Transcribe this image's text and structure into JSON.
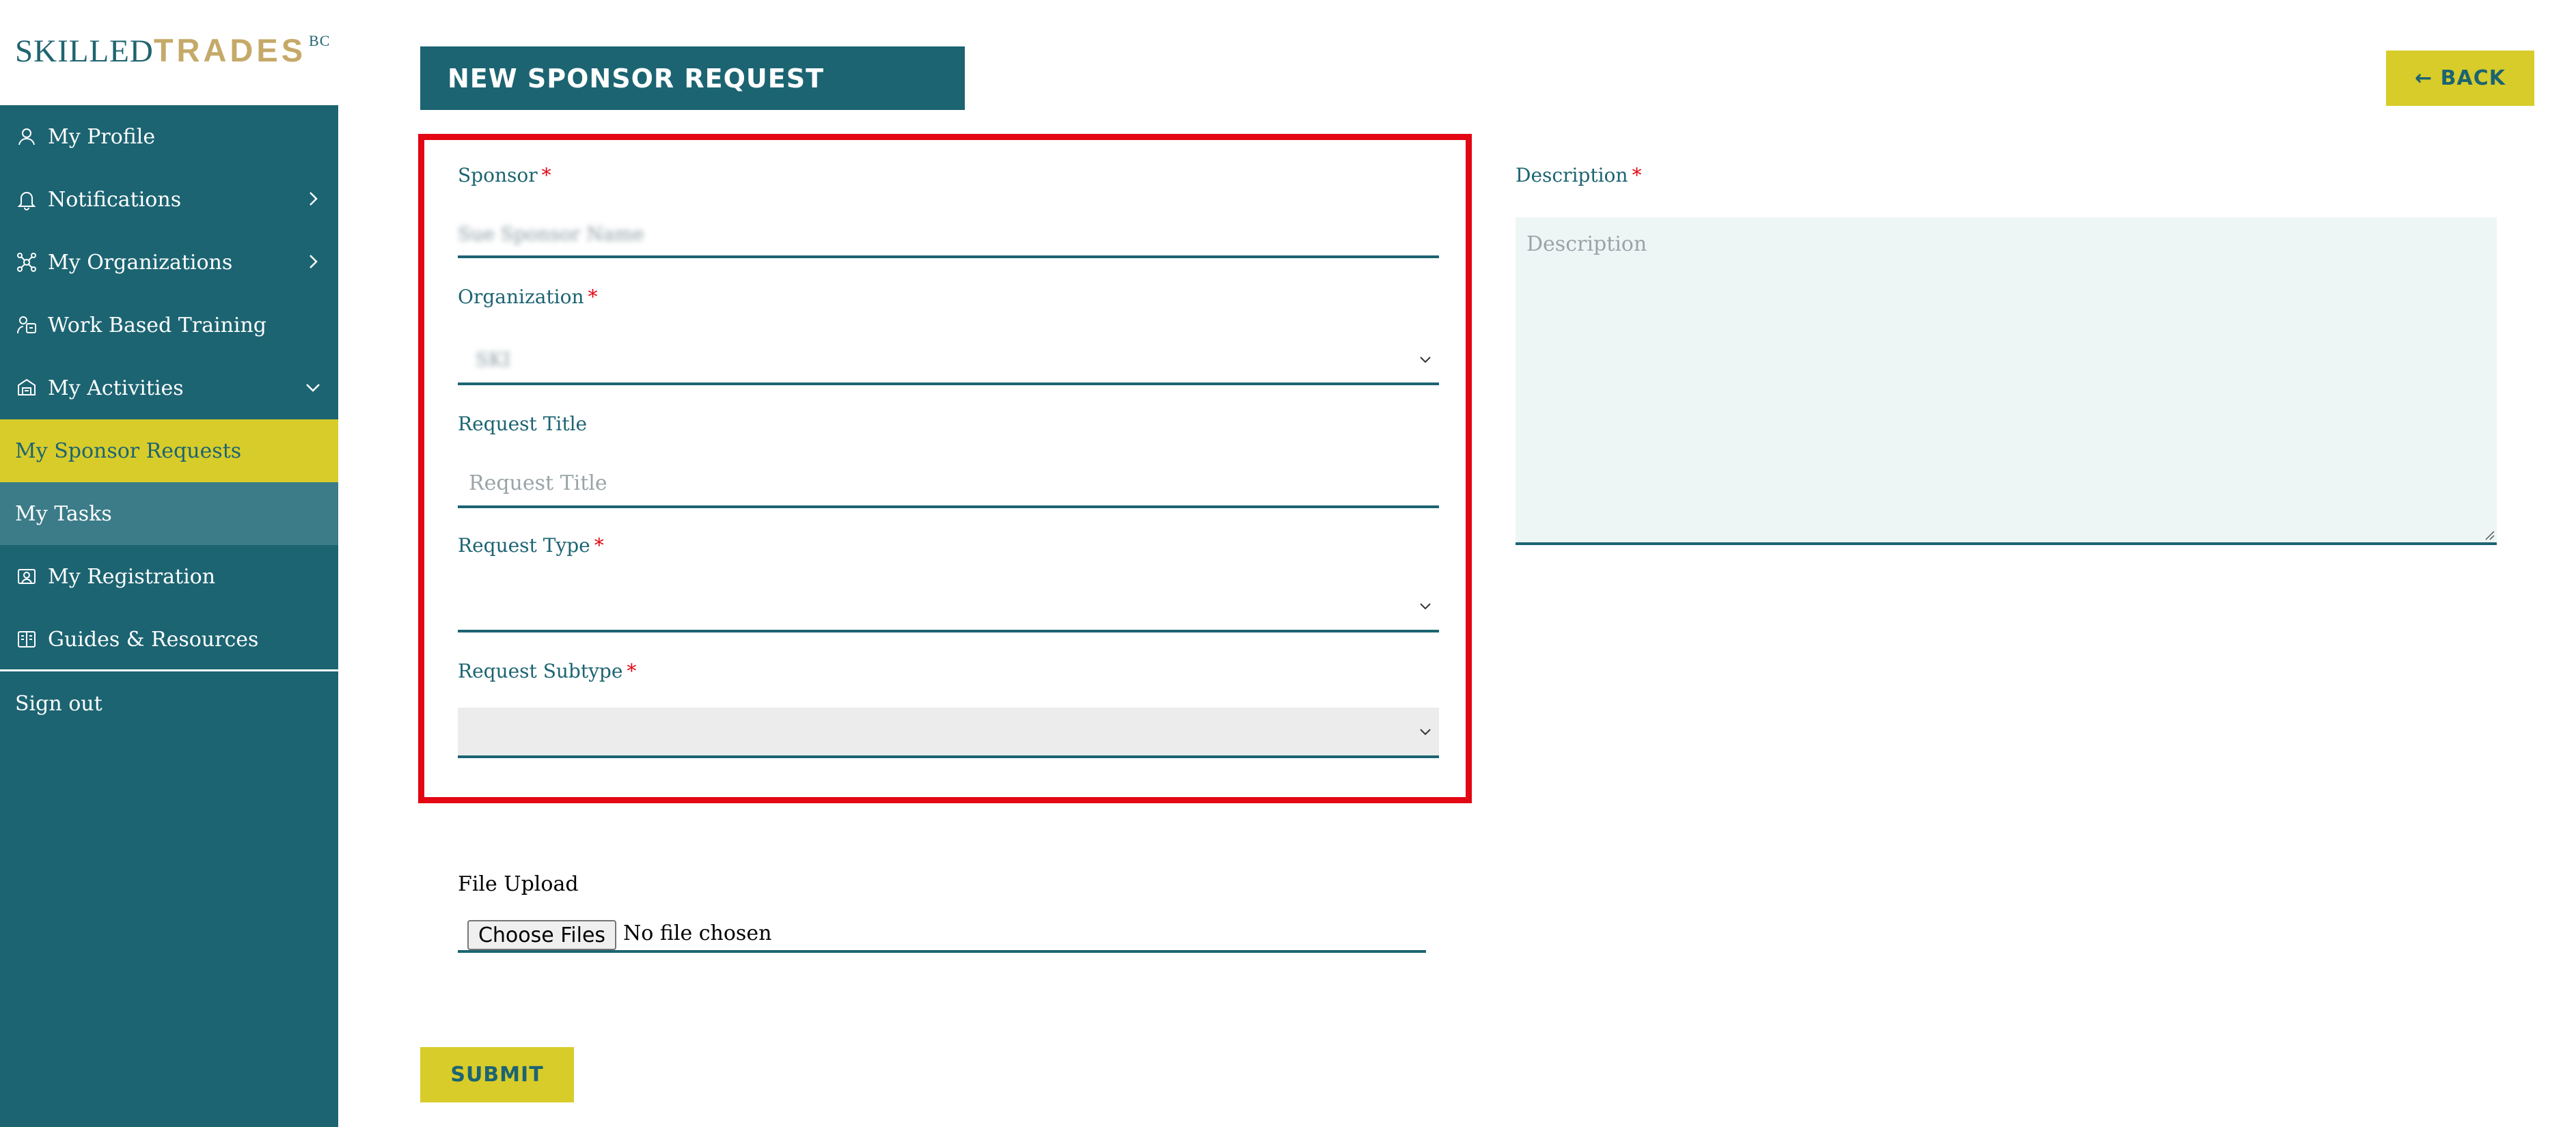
{
  "logo": {
    "part1": "SKILLED",
    "part2": "TRADES",
    "suffix": "BC"
  },
  "colors": {
    "primary": "#1c6472",
    "accent": "#d8cc2a",
    "logo_gold": "#c5a968",
    "required": "#e30613",
    "highlight": "#e30613"
  },
  "sidebar": {
    "items": [
      {
        "label": "My Profile",
        "icon": "user-icon"
      },
      {
        "label": "Notifications",
        "icon": "bell-icon",
        "chevron": "chevron-right-icon"
      },
      {
        "label": "My Organizations",
        "icon": "organization-icon",
        "chevron": "chevron-right-icon"
      },
      {
        "label": "Work Based Training",
        "icon": "training-icon"
      },
      {
        "label": "My Activities",
        "icon": "activities-icon",
        "chevron": "chevron-down-icon"
      },
      {
        "label": "My Sponsor Requests",
        "active": true
      },
      {
        "label": "My Tasks"
      },
      {
        "label": "My Registration",
        "icon": "registration-icon"
      },
      {
        "label": "Guides & Resources",
        "icon": "guides-icon"
      },
      {
        "label": "Sign out"
      }
    ]
  },
  "header": {
    "title": "NEW SPONSOR REQUEST",
    "back_label": "← BACK"
  },
  "form": {
    "required_marker": "*",
    "sponsor": {
      "label": "Sponsor",
      "value": "Sue Sponsor Name"
    },
    "organization": {
      "label": "Organization",
      "value": "SKI"
    },
    "request_title": {
      "label": "Request Title",
      "placeholder": "Request Title"
    },
    "request_type": {
      "label": "Request Type",
      "value": ""
    },
    "request_subtype": {
      "label": "Request Subtype",
      "value": ""
    },
    "description": {
      "label": "Description",
      "placeholder": "Description"
    },
    "file_upload": {
      "label": "File Upload",
      "button": "Choose Files",
      "status": "No file chosen"
    },
    "submit_label": "SUBMIT"
  }
}
